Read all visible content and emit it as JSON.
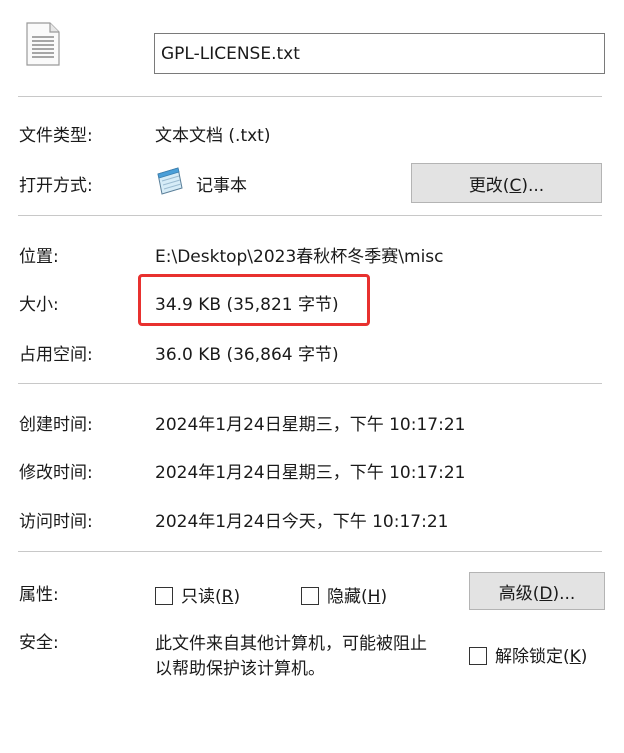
{
  "header": {
    "filename": "GPL-LICENSE.txt",
    "file_icon": "text-file-icon"
  },
  "general": {
    "type_label": "文件类型:",
    "type_value": "文本文档 (.txt)",
    "open_with_label": "打开方式:",
    "open_with_app": "记事本",
    "app_icon": "notepad-icon",
    "change_button": {
      "pre": "更改(",
      "key": "C",
      "post": ")..."
    }
  },
  "location": {
    "location_label": "位置:",
    "location_value": "E:\\Desktop\\2023春秋杯冬季赛\\misc",
    "size_label": "大小:",
    "size_value": "34.9 KB (35,821 字节)",
    "size_on_disk_label": "占用空间:",
    "size_on_disk_value": "36.0 KB (36,864 字节)",
    "highlight_color": "#e8312f"
  },
  "dates": {
    "created_label": "创建时间:",
    "created_value": "2024年1月24日星期三，下午 10:17:21",
    "modified_label": "修改时间:",
    "modified_value": "2024年1月24日星期三，下午 10:17:21",
    "accessed_label": "访问时间:",
    "accessed_value": "2024年1月24日今天，下午 10:17:21"
  },
  "attributes": {
    "label": "属性:",
    "readonly": {
      "pre": "只读(",
      "key": "R",
      "post": ")",
      "checked": false
    },
    "hidden": {
      "pre": "隐藏(",
      "key": "H",
      "post": ")",
      "checked": false
    },
    "advanced_button": {
      "pre": "高级(",
      "key": "D",
      "post": ")..."
    }
  },
  "security": {
    "label": "安全:",
    "line1": "此文件来自其他计算机，可能被阻止",
    "line2": "以帮助保护该计算机。",
    "unblock": {
      "pre": "解除锁定(",
      "key": "K",
      "post": ")",
      "checked": false
    }
  }
}
